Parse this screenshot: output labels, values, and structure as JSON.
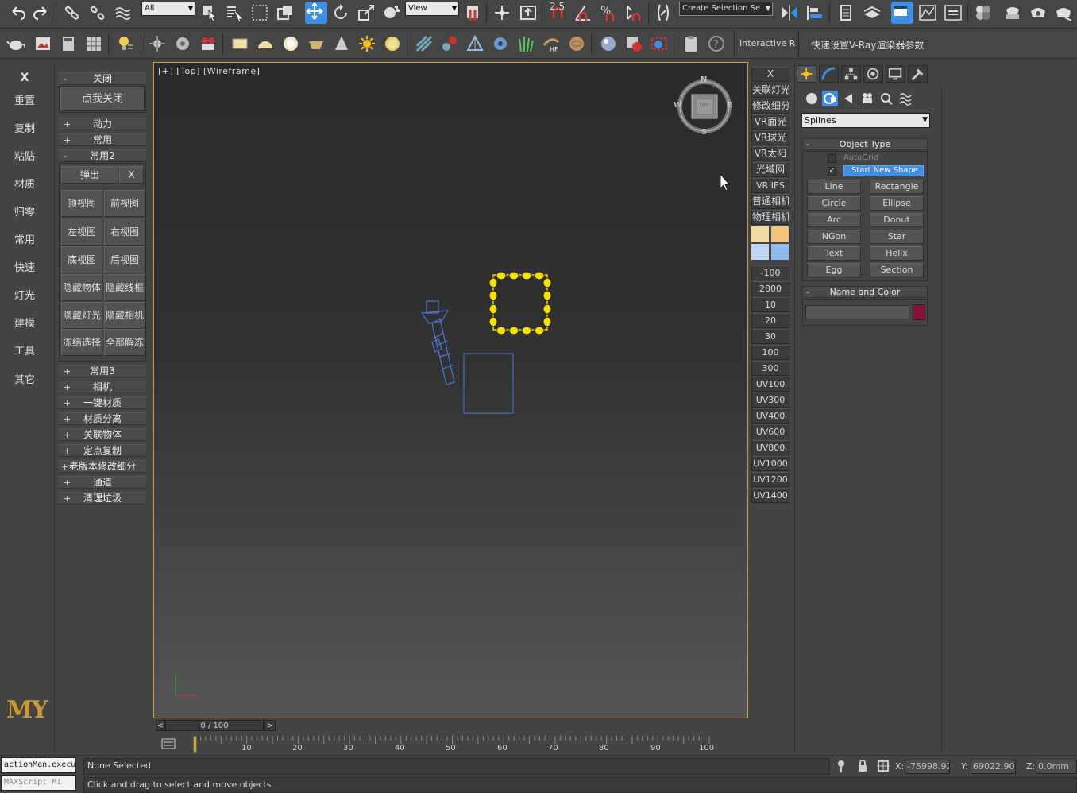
{
  "toolbar": {
    "selection_filter": "All",
    "ref_coord": "View",
    "snap_value": "2.5",
    "named_selection": "Create Selection Se",
    "interactive_label": "Interactive Rc",
    "vray_label": "快速设置V-Ray渲染器参数"
  },
  "left_menu": {
    "close": "X",
    "items": [
      "重置",
      "复制",
      "粘贴",
      "材质",
      "归零",
      "常用",
      "快速",
      "灯光",
      "建模",
      "工具",
      "其它"
    ],
    "logo": "MY"
  },
  "rollout_panel": {
    "guan_bi": {
      "sign": "-",
      "label": "关闭"
    },
    "click_close": "点我关闭",
    "dongli": {
      "sign": "+",
      "label": "动力"
    },
    "changyong": {
      "sign": "+",
      "label": "常用"
    },
    "changyong2": {
      "sign": "-",
      "label": "常用2"
    },
    "popup": "弹出",
    "popup_close": "X",
    "view_buttons": [
      "顶视图",
      "前视图",
      "左视图",
      "右视图",
      "底视图",
      "后视图",
      "隐藏物体",
      "隐藏线框",
      "隐藏灯光",
      "隐藏相机",
      "冻结选择",
      "全部解冻"
    ],
    "more": [
      {
        "sign": "+",
        "label": "常用3"
      },
      {
        "sign": "+",
        "label": "相机"
      },
      {
        "sign": "+",
        "label": "一键材质"
      },
      {
        "sign": "+",
        "label": "材质分离"
      },
      {
        "sign": "+",
        "label": "关联物体"
      },
      {
        "sign": "+",
        "label": "定点复制"
      },
      {
        "sign": "+",
        "label": "老版本修改细分"
      },
      {
        "sign": "+",
        "label": "通道"
      },
      {
        "sign": "+",
        "label": "清理垃圾"
      }
    ]
  },
  "viewport": {
    "label": "[+] [Top] [Wireframe]",
    "compass": {
      "n": "N",
      "s": "S",
      "e": "E",
      "w": "W",
      "cube": "TOP"
    }
  },
  "timeline": {
    "frame": "0 / 100",
    "prev": "<",
    "next": ">",
    "ticks": [
      "10",
      "20",
      "30",
      "40",
      "50",
      "60",
      "70",
      "80",
      "90",
      "100"
    ]
  },
  "quick_bar": {
    "close": "X",
    "items": [
      "关联灯光",
      "修改细分",
      "VR面光",
      "VR球光",
      "VR太阳",
      "光域网",
      "VR IES",
      "普通相机",
      "物理相机"
    ],
    "swatch_colors": [
      "#f7d9a3",
      "#f5c27a",
      "#bcd8f5",
      "#8fbcf0"
    ],
    "values": [
      "-100",
      "2800",
      "10",
      "20",
      "30",
      "100",
      "300",
      "UV100",
      "UV300",
      "UV400",
      "UV600",
      "UV800",
      "UV1000",
      "UV1200",
      "UV1400"
    ]
  },
  "command_panel": {
    "category": "Splines",
    "object_type": {
      "sign": "-",
      "title": "Object Type"
    },
    "autogrid": "AutoGrid",
    "start_new_shape": "Start New Shape",
    "shapes": [
      "Line",
      "Rectangle",
      "Circle",
      "Ellipse",
      "Arc",
      "Donut",
      "NGon",
      "Star",
      "Text",
      "Helix",
      "Egg",
      "Section"
    ],
    "name_color": {
      "sign": "-",
      "title": "Name and Color"
    },
    "swatch": "#8b1038"
  },
  "status": {
    "script_listener": "actionMan.execu",
    "maxscript": "MAXScript Mi",
    "selection": "None Selected",
    "prompt": "Click and drag to select and move objects",
    "x_label": "X:",
    "x_value": "-75998.92",
    "y_label": "Y:",
    "y_value": "69022.906",
    "z_label": "Z:",
    "z_value": "0.0mm"
  }
}
